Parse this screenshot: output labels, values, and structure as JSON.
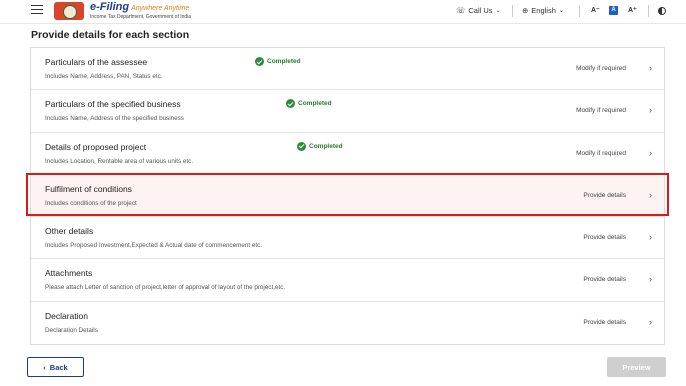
{
  "header": {
    "logo_title": "e-Filing",
    "logo_tagline": "Anywhere Anytime",
    "logo_subtitle": "Income Tax Department, Government of India",
    "call_us": "Call Us",
    "language": "English",
    "font_decrease": "A⁻",
    "font_normal": "A",
    "font_increase": "A⁺"
  },
  "page_title": "Provide details for each section",
  "sections": [
    {
      "title": "Particulars of the assessee",
      "desc": "Includes Name, Address, PAN, Status etc.",
      "status": "Completed",
      "action": "Modify if required"
    },
    {
      "title": "Particulars of the specified business",
      "desc": "Includes Name, Address of the specified business",
      "status": "Completed",
      "action": "Modify if required"
    },
    {
      "title": "Details of proposed project",
      "desc": "Includes Location, Rentable area of various units etc.",
      "status": "Completed",
      "action": "Modify if required"
    },
    {
      "title": "Fulfilment of conditions",
      "desc": "Includes conditions of the project",
      "status": "",
      "action": "Provide details"
    },
    {
      "title": "Other details",
      "desc": "Includes Proposed Investment,Expected & Actual date of commencement etc.",
      "status": "",
      "action": "Provide details"
    },
    {
      "title": "Attachments",
      "desc": "Please attach Letter of sanction of project,letter of approval of layout of the project,etc.",
      "status": "",
      "action": "Provide details"
    },
    {
      "title": "Declaration",
      "desc": "Declaration Details",
      "status": "",
      "action": "Provide details"
    }
  ],
  "buttons": {
    "back": "Back",
    "preview": "Preview"
  },
  "colors": {
    "completed": "#2a7d2e",
    "highlight_border": "#d91a1a",
    "brand_blue": "#1f3c88"
  }
}
